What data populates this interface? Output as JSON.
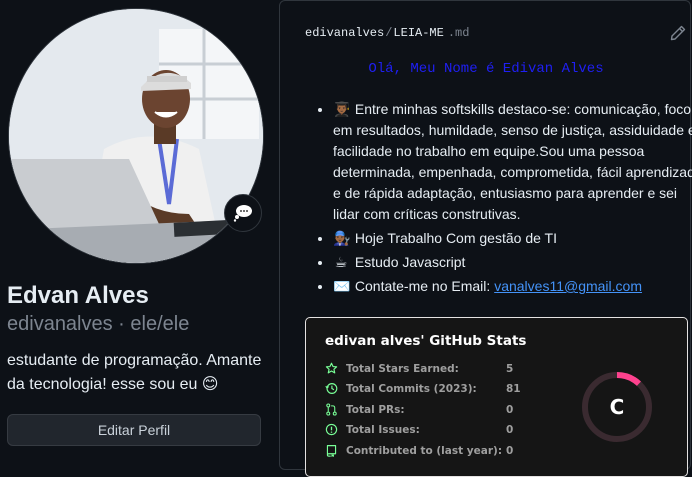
{
  "profile": {
    "name": "Edvan Alves",
    "handle": "edivanalves · ele/ele",
    "bio": "estudante de programação. Amante da tecnologia! esse sou eu 😊",
    "edit_button": "Editar Perfil",
    "status_icon": "thought-bubble-icon"
  },
  "readme": {
    "owner": "edivanalves",
    "separator": "/",
    "file": "LEIA-ME",
    "ext": ".md",
    "heading": "Olá, Meu Nome é Edivan Alves",
    "items": [
      {
        "emoji": "👨🏾‍🎓",
        "text": "Entre minhas softskills destaco-se: comunicação, foco em resultados, humildade, senso de justiça, assiduidade e facilidade no trabalho em equipe.Sou uma pessoa determinada, empenhada, comprometida, fácil aprendizado e de rápida adaptação, entusiasmo para aprender e sei lidar com críticas construtivas."
      },
      {
        "emoji": "👨🏾‍🔧",
        "text": "Hoje Trabalho Com gestão de TI"
      },
      {
        "emoji": "☕",
        "text": "Estudo Javascript"
      },
      {
        "emoji": "✉️",
        "text": "Contate-me no Email: ",
        "link": "vanalves11@gmail.com"
      }
    ]
  },
  "stats": {
    "title": "edivan alves' GitHub Stats",
    "rows": [
      {
        "icon": "star-icon",
        "label": "Total Stars Earned:",
        "value": "5"
      },
      {
        "icon": "history-icon",
        "label": "Total Commits (2023):",
        "value": "81"
      },
      {
        "icon": "pull-request-icon",
        "label": "Total PRs:",
        "value": "0"
      },
      {
        "icon": "issue-icon",
        "label": "Total Issues:",
        "value": "0"
      },
      {
        "icon": "repo-icon",
        "label": "Contributed to (last year):",
        "value": "0"
      }
    ],
    "rank": "C",
    "rank_progress": 0.12,
    "colors": {
      "icon": "#79ff97",
      "ring": "#fe428e",
      "bg": "#151515"
    }
  }
}
